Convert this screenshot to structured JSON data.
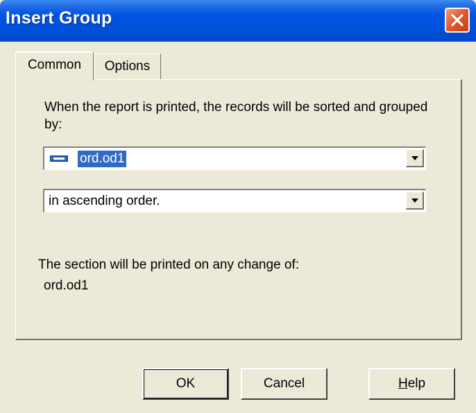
{
  "window": {
    "title": "Insert Group",
    "close_icon": "close-icon"
  },
  "tabs": [
    {
      "label": "Common",
      "active": true
    },
    {
      "label": "Options",
      "active": false
    }
  ],
  "common": {
    "prompt": "When the report is printed, the records will be sorted and grouped by:",
    "group_field": {
      "value": "ord.od1",
      "icon": "database-field-icon"
    },
    "sort_order": {
      "value": "in ascending order."
    },
    "section_note": "The section will be printed on any change of:",
    "section_field": "ord.od1"
  },
  "buttons": {
    "ok": "OK",
    "cancel": "Cancel",
    "help": "Help",
    "help_hotkey": "H",
    "help_rest": "elp"
  },
  "colors": {
    "titlebar": "#0054e3",
    "close_button": "#e35b32",
    "dialog_bg": "#ece9d8",
    "selection": "#316ac5"
  }
}
